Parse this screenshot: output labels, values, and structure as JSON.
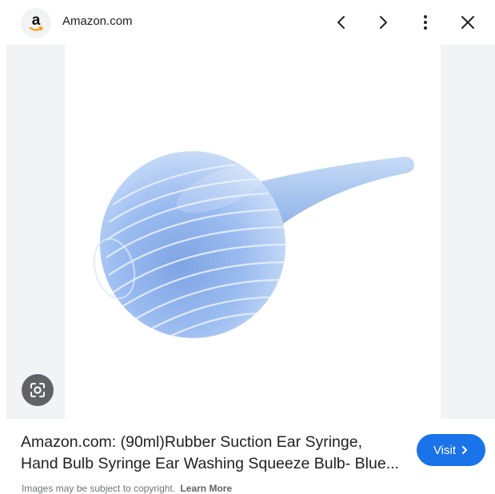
{
  "header": {
    "favicon_letter": "a",
    "site_name": "Amazon.com",
    "icons": [
      "previous-icon",
      "next-icon",
      "more-options-icon",
      "close-icon"
    ]
  },
  "image": {
    "subject_icon": "rubber-bulb-syringe-photo",
    "lens_icon": "google-lens-icon"
  },
  "result": {
    "title_line1": "Amazon.com: (90ml)Rubber Suction Ear Syringe,",
    "title_line2": "Hand Bulb Syringe Ear Washing Squeeze Bulb- Blue...",
    "visit_label": "Visit",
    "copyright_text": "Images may be subject to copyright.",
    "learn_more_label": "Learn More"
  },
  "colors": {
    "accent": "#1a73e8",
    "side_background": "#f1f3f4",
    "lens_button": "#5f6368",
    "product_blue": "#a9c6ef"
  }
}
